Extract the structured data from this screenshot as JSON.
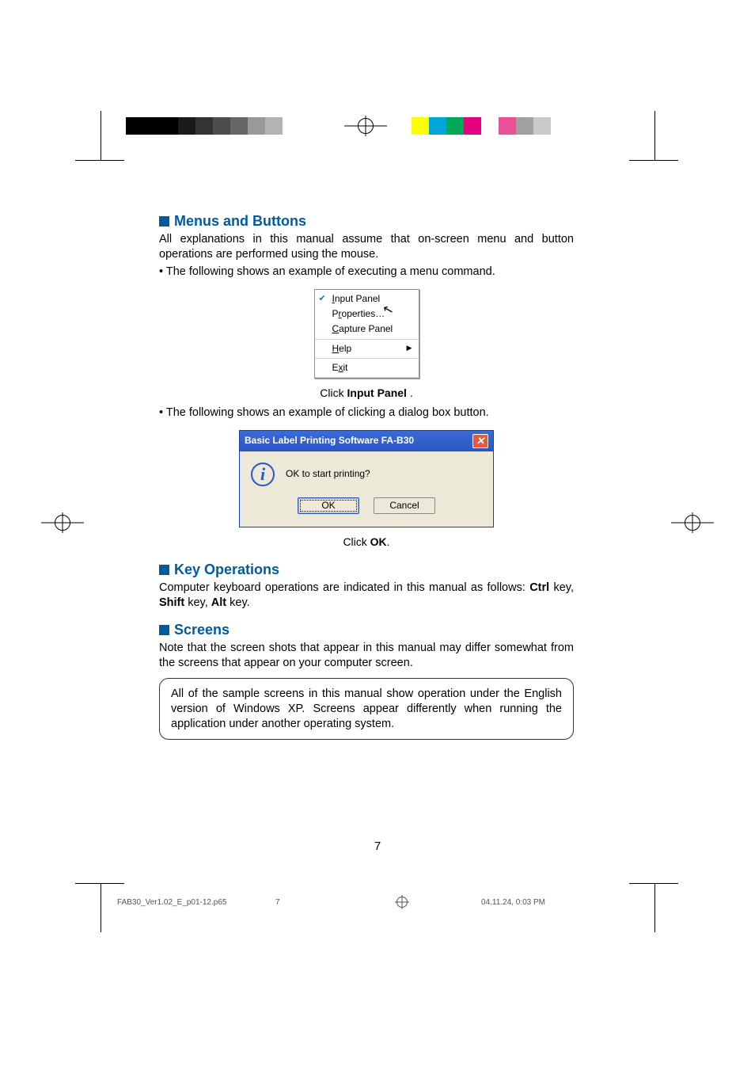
{
  "sections": {
    "menus": {
      "heading": "Menus and Buttons",
      "para1": "All explanations in this manual assume that on-screen menu and button operations are performed using the mouse.",
      "bullet1": "The following shows an example of executing a menu command.",
      "caption1_a": "Click ",
      "caption1_b": "Input Panel",
      "caption1_c": " .",
      "bullet2": "The following shows an example of clicking a dialog box button.",
      "caption2_a": "Click ",
      "caption2_b": "OK",
      "caption2_c": "."
    },
    "keyops": {
      "heading": "Key Operations",
      "text_a": "Computer keyboard operations are indicated in this manual as follows: ",
      "k1": "Ctrl",
      "mid1": " key, ",
      "k2": "Shift",
      "mid2": " key, ",
      "k3": "Alt",
      "tail": " key."
    },
    "screens": {
      "heading": "Screens",
      "para": "Note that the screen shots that appear in this manual may differ somewhat from the screens that appear on your computer screen.",
      "note": "All of the sample screens in this manual show operation under the English version of Windows XP. Screens appear differently when running the application under another operating system."
    }
  },
  "menu": {
    "items": {
      "input_panel": "Input Panel",
      "properties": "Properties…",
      "capture_panel": "Capture Panel",
      "help": "Help",
      "exit": "Exit"
    }
  },
  "dialog": {
    "title": "Basic Label Printing Software FA-B30",
    "message": "OK to start printing?",
    "ok": "OK",
    "cancel": "Cancel"
  },
  "page_number": "7",
  "footer": {
    "file": "FAB30_Ver1.02_E_p01-12.p65",
    "page": "7",
    "timestamp": "04.11.24, 0:03 PM"
  },
  "colors": {
    "grayscale": [
      "#000000",
      "#000000",
      "#000000",
      "#1a1a1a",
      "#333333",
      "#4d4d4d",
      "#666666",
      "#999999",
      "#b3b3b3",
      "#ffffff"
    ],
    "process": [
      "#ffff00",
      "#00a5d9",
      "#00a859",
      "#e5007e",
      "#ffffff",
      "#e95098",
      "#a0a0a0",
      "#c9c9c9"
    ]
  }
}
